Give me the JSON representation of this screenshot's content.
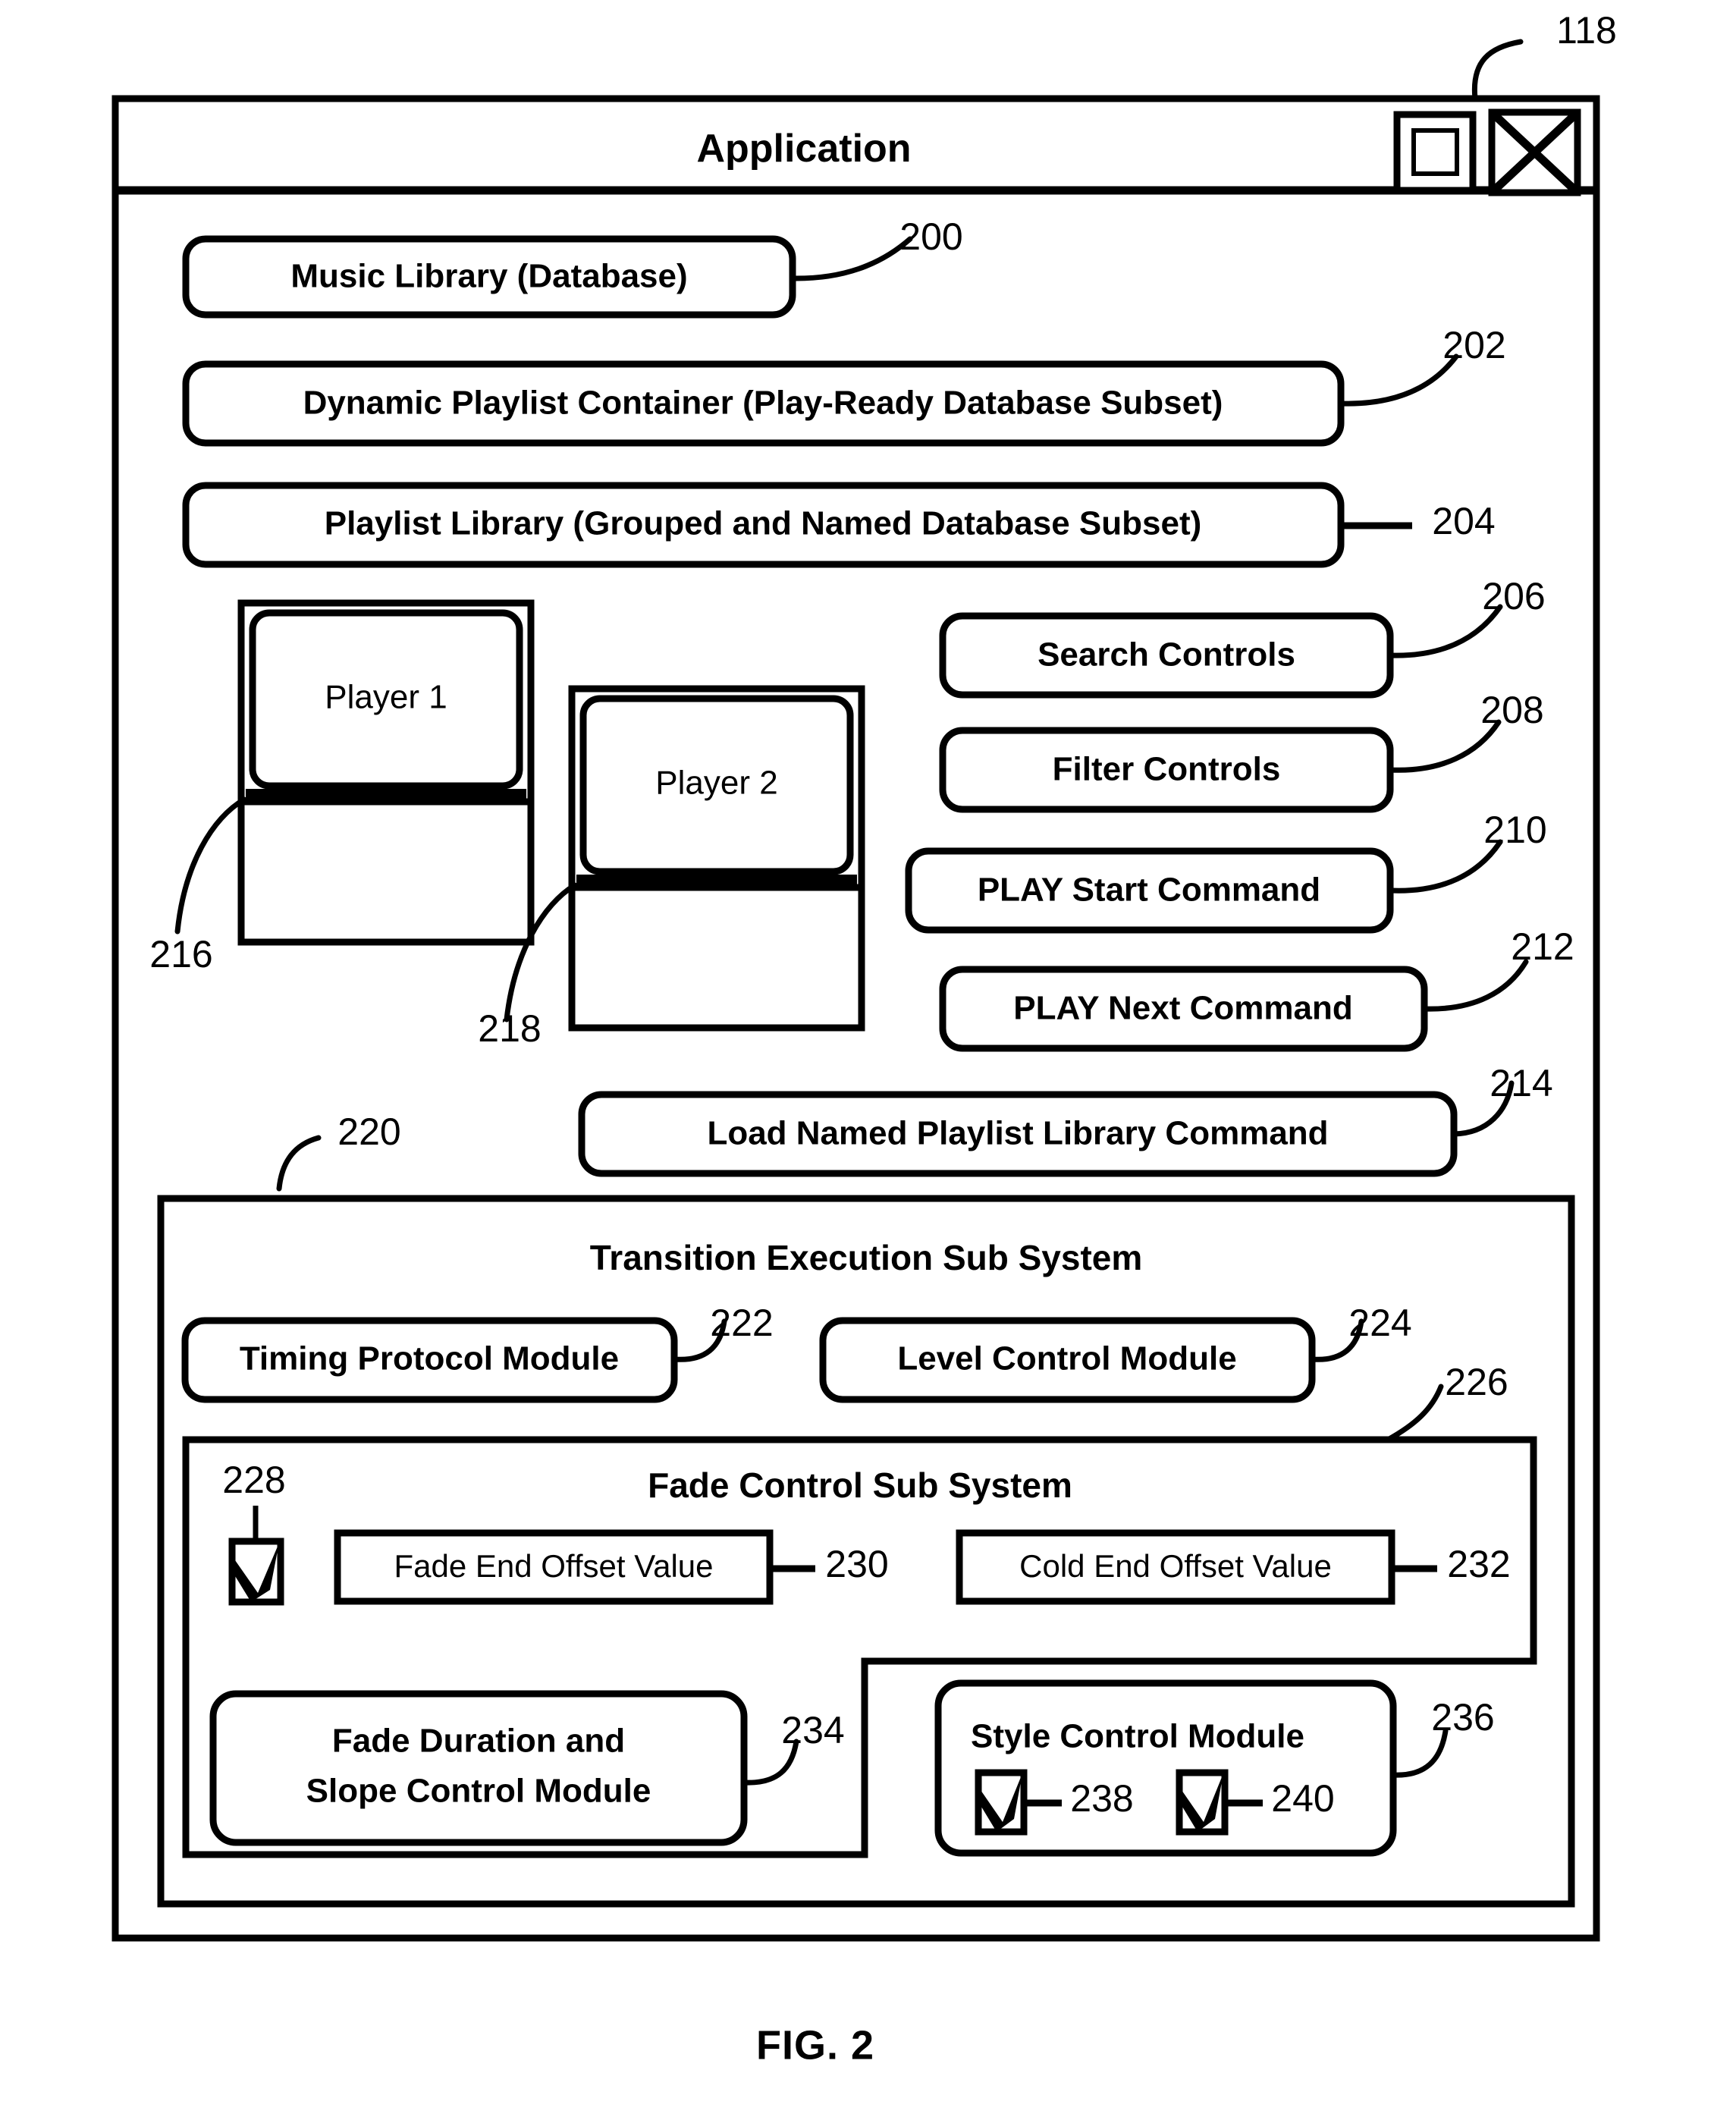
{
  "figure": {
    "caption": "FIG. 2",
    "window_title": "Application"
  },
  "window_controls": {
    "maximize_icon": "maximize-icon",
    "close_icon": "close-icon",
    "ref": "118"
  },
  "blocks": [
    {
      "id": "music-library",
      "label": "Music Library  (Database)",
      "ref": "200"
    },
    {
      "id": "dynamic-playlist",
      "label": "Dynamic Playlist Container  (Play-Ready Database Subset)",
      "ref": "202"
    },
    {
      "id": "playlist-library",
      "label": "Playlist Library  (Grouped and Named Database Subset)",
      "ref": "204"
    },
    {
      "id": "search-controls",
      "label": "Search Controls",
      "ref": "206"
    },
    {
      "id": "filter-controls",
      "label": "Filter Controls",
      "ref": "208"
    },
    {
      "id": "play-start-command",
      "label": "PLAY Start Command",
      "ref": "210"
    },
    {
      "id": "play-next-command",
      "label": "PLAY Next Command",
      "ref": "212"
    },
    {
      "id": "load-named-playlist",
      "label": "Load Named Playlist Library Command",
      "ref": "214"
    }
  ],
  "players": [
    {
      "id": "player-1",
      "label": "Player 1",
      "ref": "216"
    },
    {
      "id": "player-2",
      "label": "Player 2",
      "ref": "218"
    }
  ],
  "player_controls": {
    "scrub_knob_icon": "scrub-knob-icon",
    "play_icon": "play-icon",
    "pause_icon": "pause-icon",
    "stop_icon": "stop-icon",
    "ellipse_icon": "ellipse-icon",
    "volume_icon": "volume-icon",
    "progress_bar": "progress-bar",
    "status_bar": "status-bar"
  },
  "transition_subsystem": {
    "title": "Transition Execution Sub System",
    "ref": "220",
    "modules": [
      {
        "id": "timing-protocol-module",
        "label": "Timing Protocol Module",
        "ref": "222"
      },
      {
        "id": "level-control-module",
        "label": "Level Control Module",
        "ref": "224"
      }
    ]
  },
  "fade_subsystem": {
    "title": "Fade Control Sub System",
    "ref": "226",
    "enable_checkbox": {
      "id": "fade-enable-checkbox",
      "checked": true,
      "ref": "228"
    },
    "values": [
      {
        "id": "fade-end-offset-value",
        "label": "Fade End Offset Value",
        "ref": "230"
      },
      {
        "id": "cold-end-offset-value",
        "label": "Cold End Offset Value",
        "ref": "232"
      }
    ],
    "modules": [
      {
        "id": "fade-duration-slope-module",
        "label_line1": "Fade Duration and",
        "label_line2": "Slope Control Module",
        "ref": "234"
      },
      {
        "id": "style-control-module",
        "label": "Style Control Module",
        "ref": "236",
        "checkboxes": [
          {
            "id": "style-checkbox-a",
            "checked": true,
            "ref": "238"
          },
          {
            "id": "style-checkbox-b",
            "checked": true,
            "ref": "240"
          }
        ]
      }
    ]
  },
  "colors": {
    "ink": "#000000",
    "paper": "#ffffff"
  }
}
